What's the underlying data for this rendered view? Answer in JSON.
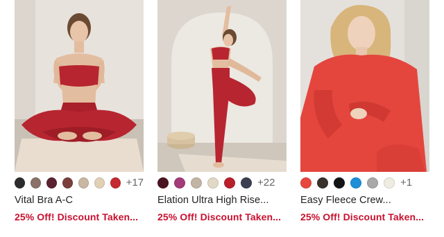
{
  "products": [
    {
      "name": "Vital Bra A-C",
      "promo": "25% Off! Discount Taken...",
      "image_alt": "woman in red sports bra and leggings seated in lotus pose",
      "swatches": [
        "#2c2c2c",
        "#8a7366",
        "#5a2230",
        "#7b3f3b",
        "#c9b7a3",
        "#e0d0b6",
        "#c42a2f"
      ],
      "more_colors": "+17"
    },
    {
      "name": "Elation Ultra High Rise...",
      "promo": "25% Off! Discount Taken...",
      "image_alt": "woman in red bra and leggings standing in tree pose with arm raised",
      "swatches": [
        "#4a1520",
        "#a43a7a",
        "#c3b5a4",
        "#e2d8c6",
        "#b8202b",
        "#3a3f52"
      ],
      "more_colors": "+22"
    },
    {
      "name": "Easy Fleece Crew...",
      "promo": "25% Off! Discount Taken...",
      "image_alt": "smiling woman in red fleece crew sweatshirt seated on wooden chair",
      "swatches": [
        "#e8473e",
        "#3a302c",
        "#141414",
        "#1c8fd8",
        "#a8a8a8",
        "#efece2"
      ],
      "more_colors": "+1"
    }
  ]
}
